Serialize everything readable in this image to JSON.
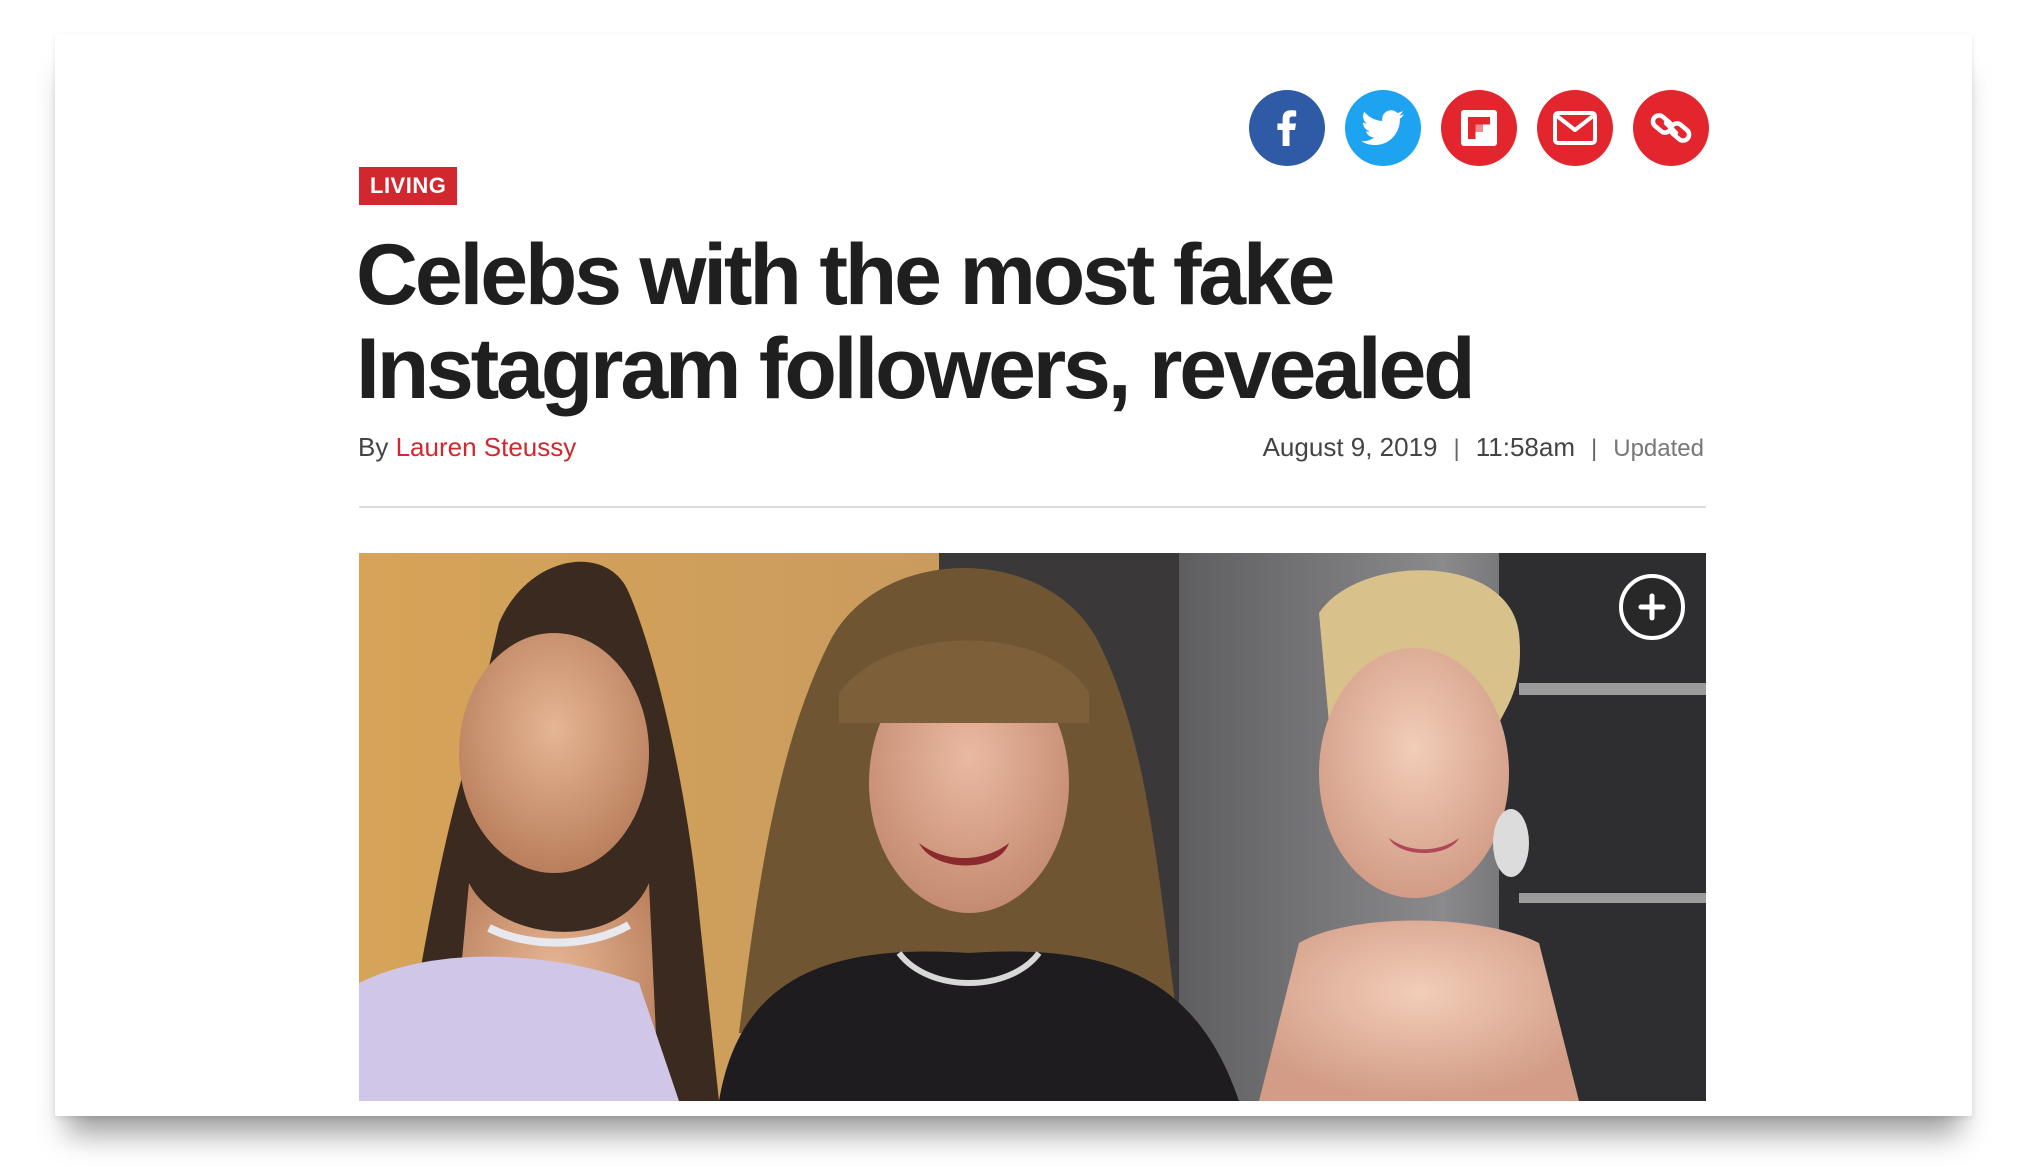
{
  "article": {
    "section": "LIVING",
    "headline": "Celebs with the most fake Instagram followers, revealed",
    "byline_prefix": "By",
    "author": "Lauren Steussy",
    "date": "August 9, 2019",
    "time": "11:58am",
    "separator": "|",
    "updated_label": "Updated"
  },
  "share": {
    "buttons": [
      {
        "icon": "facebook-icon",
        "color": "#2f5aa6"
      },
      {
        "icon": "twitter-icon",
        "color": "#1ea3f0"
      },
      {
        "icon": "flipboard-icon",
        "color": "#e3262e"
      },
      {
        "icon": "email-icon",
        "color": "#e3262e"
      },
      {
        "icon": "link-icon",
        "color": "#e3262e"
      }
    ]
  },
  "hero_image": {
    "expand_icon": "plus-circle-icon"
  },
  "colors": {
    "accent": "#d0282e",
    "headline": "#1f1f1f"
  }
}
